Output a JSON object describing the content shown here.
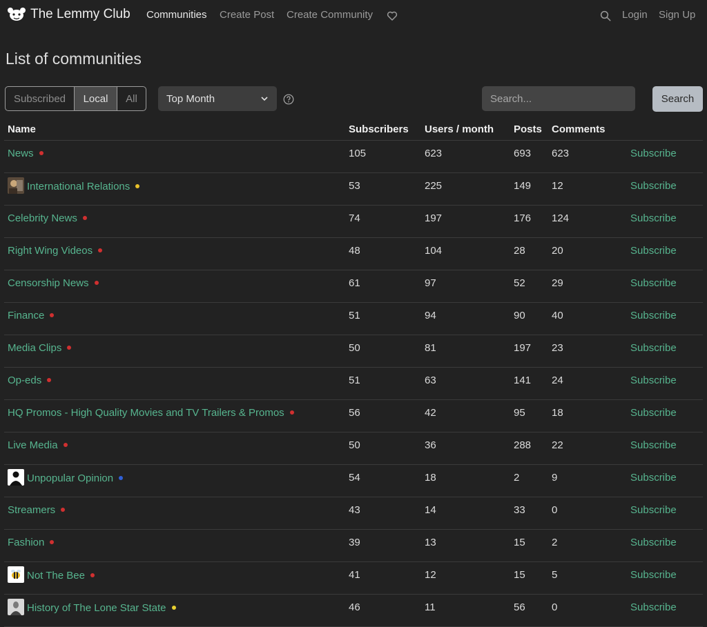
{
  "navbar": {
    "brand": "The Lemmy Club",
    "links": [
      "Communities",
      "Create Post",
      "Create Community"
    ],
    "login": "Login",
    "signup": "Sign Up"
  },
  "page": {
    "title": "List of communities"
  },
  "filters": {
    "listing_types": [
      "Subscribed",
      "Local",
      "All"
    ],
    "active_listing": "Local",
    "sort": "Top Month"
  },
  "search": {
    "placeholder": "Search...",
    "button": "Search"
  },
  "table": {
    "headers": [
      "Name",
      "Subscribers",
      "Users / month",
      "Posts",
      "Comments"
    ],
    "subscribe_label": "Subscribe",
    "rows": [
      {
        "name": "News",
        "avatar": "",
        "dot": "#d03030",
        "subscribers": "105",
        "users_month": "623",
        "posts": "693",
        "comments": "623"
      },
      {
        "name": "International Relations",
        "avatar": "photo",
        "dot": "#e8c02a",
        "subscribers": "53",
        "users_month": "225",
        "posts": "149",
        "comments": "12"
      },
      {
        "name": "Celebrity News",
        "avatar": "",
        "dot": "#d03030",
        "subscribers": "74",
        "users_month": "197",
        "posts": "176",
        "comments": "124"
      },
      {
        "name": "Right Wing Videos",
        "avatar": "",
        "dot": "#d03030",
        "subscribers": "48",
        "users_month": "104",
        "posts": "28",
        "comments": "20"
      },
      {
        "name": "Censorship News",
        "avatar": "",
        "dot": "#d03030",
        "subscribers": "61",
        "users_month": "97",
        "posts": "52",
        "comments": "29"
      },
      {
        "name": "Finance",
        "avatar": "",
        "dot": "#d03030",
        "subscribers": "51",
        "users_month": "94",
        "posts": "90",
        "comments": "40"
      },
      {
        "name": "Media Clips",
        "avatar": "",
        "dot": "#d03030",
        "subscribers": "50",
        "users_month": "81",
        "posts": "197",
        "comments": "23"
      },
      {
        "name": "Op-eds",
        "avatar": "",
        "dot": "#d03030",
        "subscribers": "51",
        "users_month": "63",
        "posts": "141",
        "comments": "24"
      },
      {
        "name": "HQ Promos - High Quality Movies and TV Trailers & Promos",
        "avatar": "",
        "dot": "#d03030",
        "subscribers": "56",
        "users_month": "42",
        "posts": "95",
        "comments": "18"
      },
      {
        "name": "Live Media",
        "avatar": "",
        "dot": "#d03030",
        "subscribers": "50",
        "users_month": "36",
        "posts": "288",
        "comments": "22"
      },
      {
        "name": "Unpopular Opinion",
        "avatar": "silhouette",
        "dot": "#3060d8",
        "subscribers": "54",
        "users_month": "18",
        "posts": "2",
        "comments": "9"
      },
      {
        "name": "Streamers",
        "avatar": "",
        "dot": "#d03030",
        "subscribers": "43",
        "users_month": "14",
        "posts": "33",
        "comments": "0"
      },
      {
        "name": "Fashion",
        "avatar": "",
        "dot": "#d03030",
        "subscribers": "39",
        "users_month": "13",
        "posts": "15",
        "comments": "2"
      },
      {
        "name": "Not The Bee",
        "avatar": "bee",
        "dot": "#d03030",
        "subscribers": "41",
        "users_month": "12",
        "posts": "15",
        "comments": "5"
      },
      {
        "name": "History of The Lone Star State",
        "avatar": "portrait",
        "dot": "#e8d030",
        "subscribers": "46",
        "users_month": "11",
        "posts": "56",
        "comments": "0"
      }
    ]
  }
}
